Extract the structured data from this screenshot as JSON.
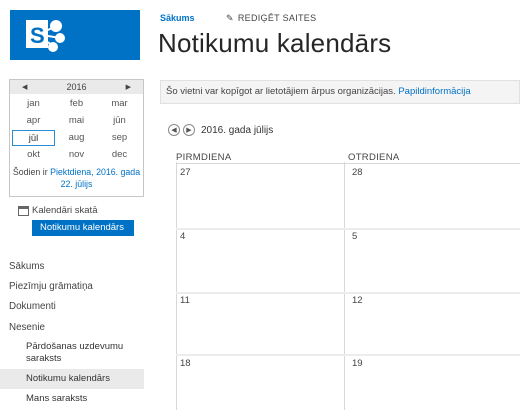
{
  "header": {
    "breadcrumb": "Sākums",
    "edit_links": "REDIĢĒT SAITES",
    "page_title": "Notikumu kalendārs"
  },
  "notice": {
    "text": "Šo vietni var kopīgot ar lietotājiem ārpus organizācijas.",
    "link": "Papildinformācija"
  },
  "mini_calendar": {
    "year": "2016",
    "prev_icon": "left-arrow",
    "next_icon": "right-arrow",
    "months": [
      "jan",
      "feb",
      "mar",
      "apr",
      "mai",
      "jūn",
      "jūl",
      "aug",
      "sep",
      "okt",
      "nov",
      "dec"
    ],
    "selected_month": "jūl",
    "today_prefix": "Šodien ir",
    "today_link": "Piektdiena, 2016. gada 22. jūlijs"
  },
  "calendar_views": {
    "heading": "Kalendāri skatā",
    "selected": "Notikumu kalendārs"
  },
  "leftnav": {
    "items": [
      "Sākums",
      "Piezīmju grāmatiņa",
      "Dokumenti",
      "Nesenie"
    ],
    "recent": [
      "Pārdošanas uzdevumu",
      "saraksts",
      "Notikumu kalendārs",
      "Mans saraksts"
    ]
  },
  "month_nav": {
    "label": "2016. gada jūlijs"
  },
  "calendar": {
    "columns": [
      "PIRMDIENA",
      "OTRDIENA"
    ],
    "rows": [
      [
        "27",
        "28"
      ],
      [
        "4",
        "5"
      ],
      [
        "11",
        "12"
      ],
      [
        "18",
        "19"
      ]
    ]
  },
  "colors": {
    "brand_blue": "#0072c6",
    "nav_active_bg": "#eaeaea"
  }
}
